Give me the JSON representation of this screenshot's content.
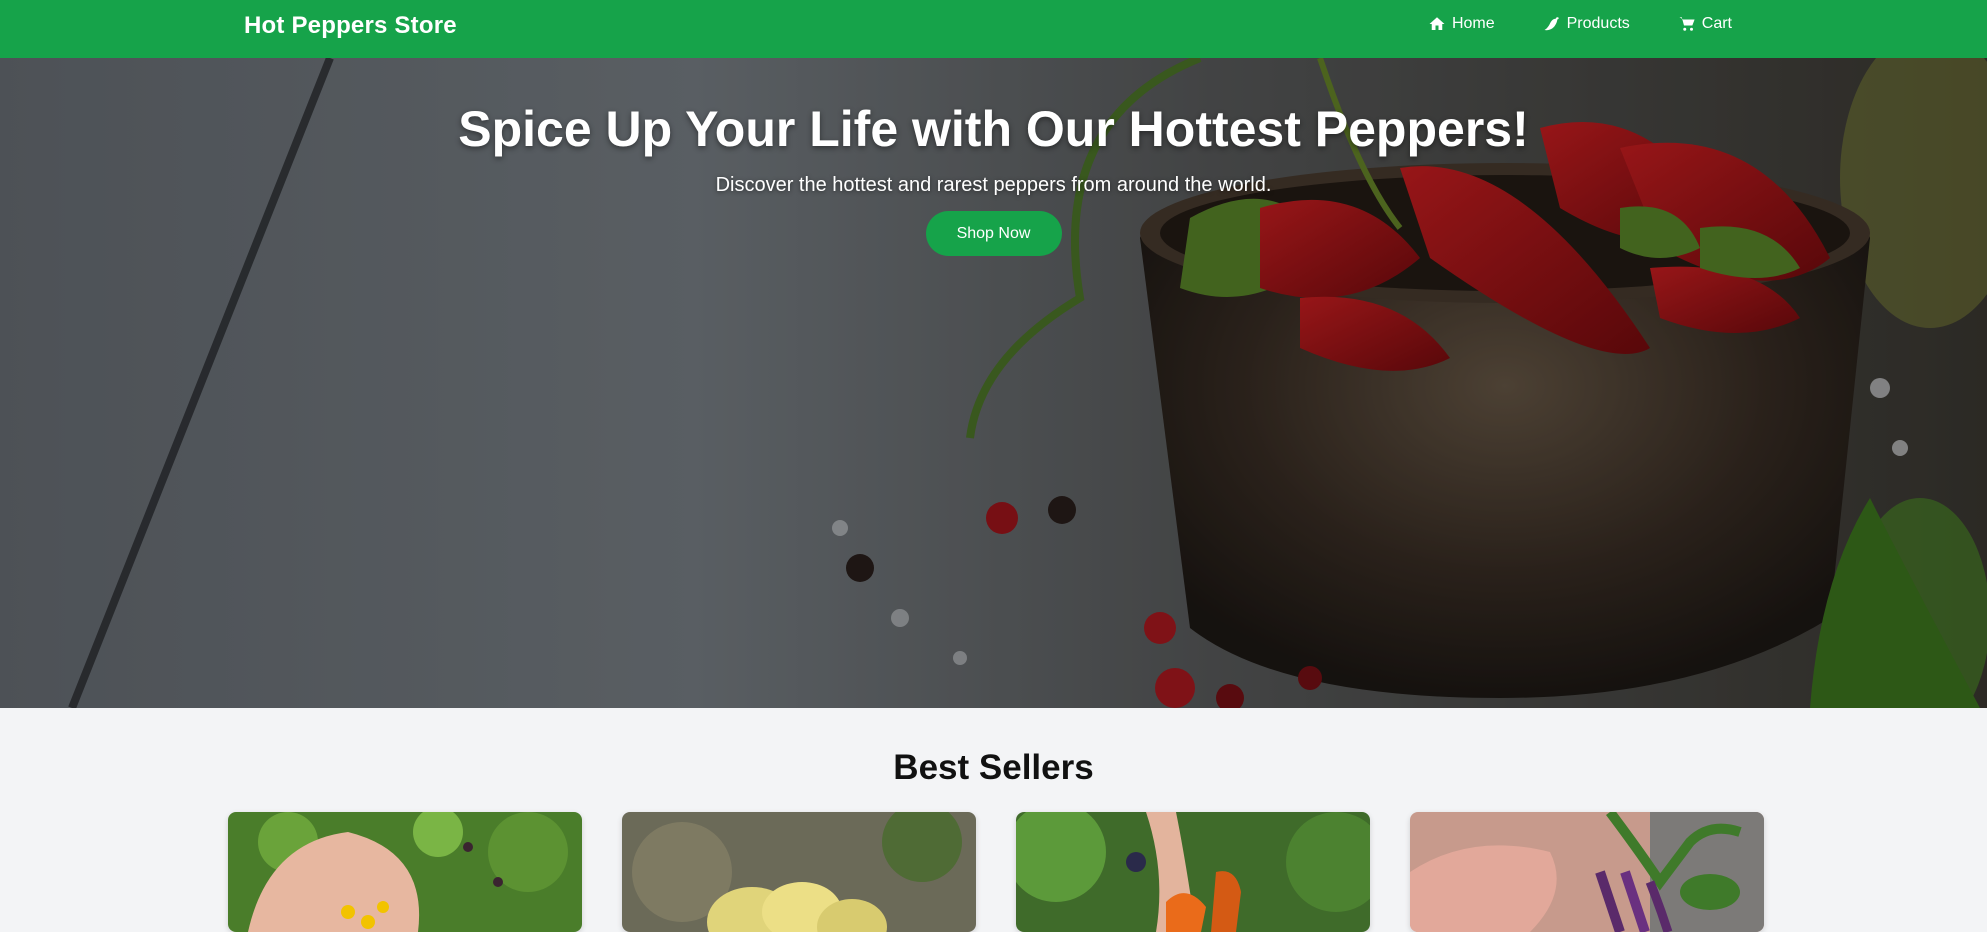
{
  "navbar": {
    "brand": "Hot Peppers Store",
    "links": [
      {
        "label": "Home",
        "icon": "home-icon"
      },
      {
        "label": "Products",
        "icon": "pepper-icon"
      },
      {
        "label": "Cart",
        "icon": "cart-icon"
      }
    ],
    "color": "#16a34a"
  },
  "hero": {
    "title": "Spice Up Your Life with Our Hottest Peppers!",
    "subtitle": "Discover the hottest and rarest peppers from around the world.",
    "cta_label": "Shop Now"
  },
  "best_sellers": {
    "title": "Best Sellers",
    "products": [
      {
        "image": "yellow peppers in hand"
      },
      {
        "image": "yellow habanero peppers"
      },
      {
        "image": "orange peppers on plant"
      },
      {
        "image": "purple peppers on plant"
      }
    ]
  }
}
